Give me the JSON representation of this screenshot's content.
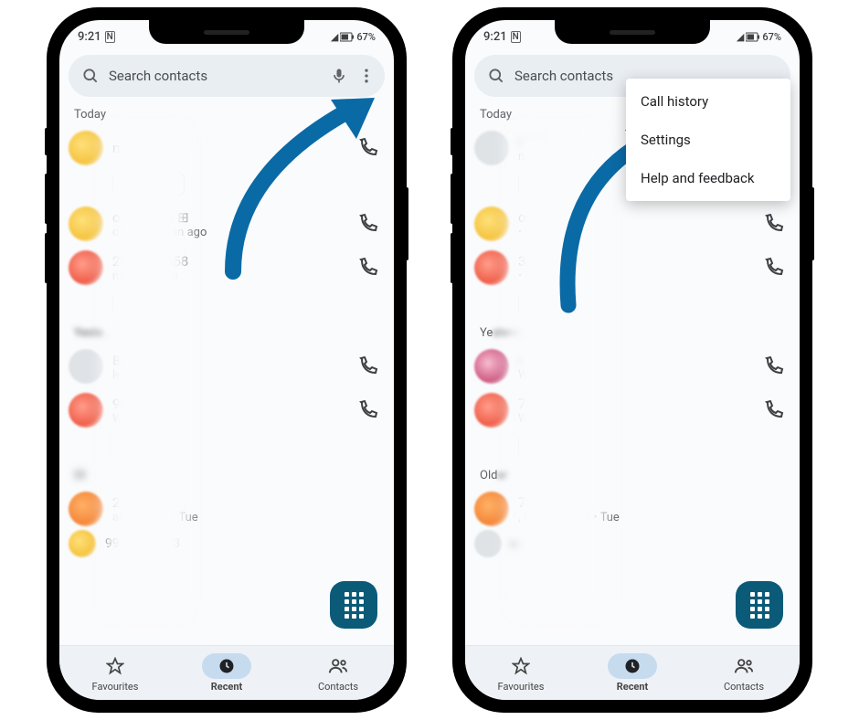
{
  "status": {
    "time": "9:21",
    "battery": "67%"
  },
  "search": {
    "placeholder": "Search contacts"
  },
  "sections": {
    "today": "Today",
    "yesterday": "Yesterday",
    "older": "Older"
  },
  "calls": [
    {
      "title": "min ago",
      "sub": "",
      "chip": "Not spam",
      "avatar": "yellow"
    },
    {
      "title": "omer care ⊞",
      "sub": "obile • 15 min ago",
      "avatar": "yellow"
    },
    {
      "title": "20 322 4358",
      "sub": "nk • 6:10 pm",
      "chip": "ot spam",
      "avatar": "red"
    },
    {
      "title": " ⊞",
      "sub": "le • Wed",
      "avatar": "gray"
    },
    {
      "title": "994 4969",
      "sub": "Wed",
      "chip": "",
      "avatar": "red"
    },
    {
      "title": "2       9718",
      "sub": "aharashtra • Tue",
      "avatar": "orange"
    },
    {
      "title": "99248 63693",
      "sub": "",
      "avatar": "yellow"
    }
  ],
  "calls2": [
    {
      "title": "",
      "sub": "n. ago",
      "chip": "t spam",
      "avatar": "gray"
    },
    {
      "title": "or care ⊞",
      "sub": "• 15 min ago",
      "avatar": "yellow"
    },
    {
      "title": " 322 4358",
      "sub": "• 6:10 pm",
      "chip": "  spam",
      "avatar": "red"
    },
    {
      "title": "",
      "sub": "  Wed",
      "avatar": "pink"
    },
    {
      "title": "781 4969",
      "sub": "Wed",
      "chip": "   am",
      "avatar": "red"
    },
    {
      "title": "781 9718",
      "sub": ", Maharashtra • Tue",
      "avatar": "orange"
    }
  ],
  "nav": {
    "fav": "Favourites",
    "recent": "Recent",
    "contacts": "Contacts"
  },
  "menu": {
    "history": "Call history",
    "settings": "Settings",
    "help": "Help and feedback"
  }
}
